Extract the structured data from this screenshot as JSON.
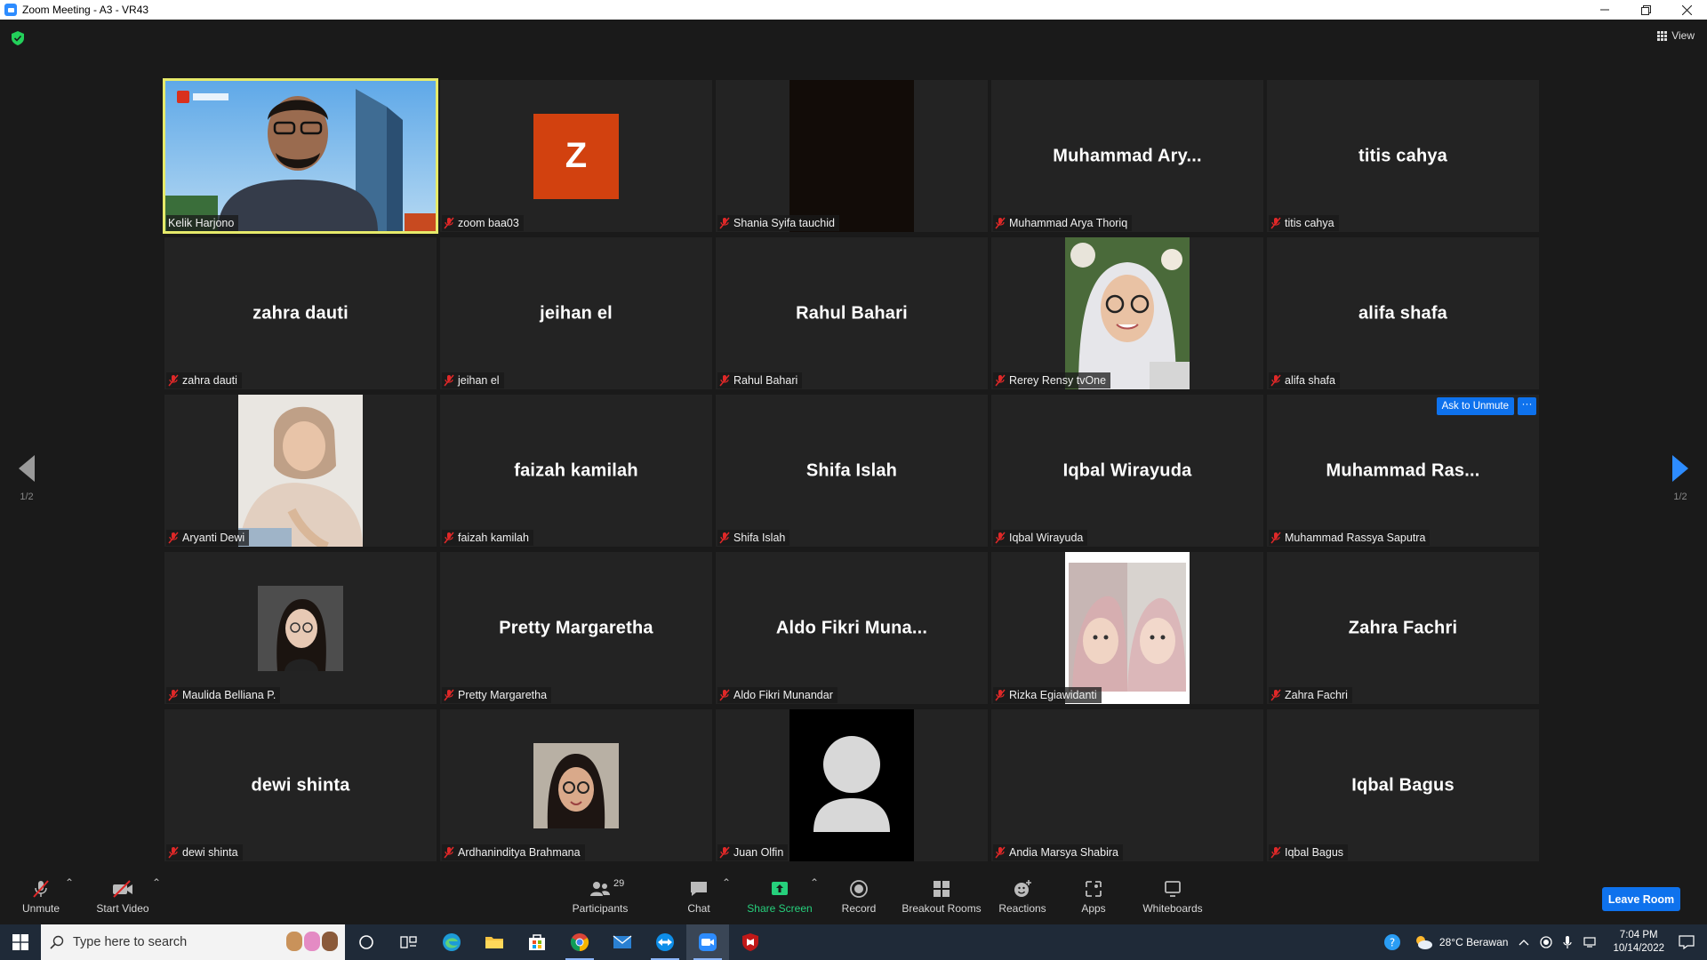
{
  "window": {
    "title": "Zoom Meeting - A3 - VR43"
  },
  "meeting": {
    "view_label": "View",
    "page_left": "1/2",
    "page_right": "1/2",
    "ask_unmute_label": "Ask to Unmute",
    "more_label": "···",
    "tiles": [
      {
        "name": "Kelik Harjono",
        "big": "",
        "type": "video-speaker"
      },
      {
        "name": "zoom baa03",
        "big": "",
        "type": "letter-avatar",
        "letter": "Z"
      },
      {
        "name": "Shania Syifa tauchid",
        "big": "",
        "type": "dark-video"
      },
      {
        "name": "Muhammad Arya Thoriq",
        "big": "Muhammad  Ary...",
        "type": "name"
      },
      {
        "name": "titis cahya",
        "big": "titis cahya",
        "type": "name"
      },
      {
        "name": "zahra dauti",
        "big": "zahra dauti",
        "type": "name"
      },
      {
        "name": "jeihan el",
        "big": "jeihan el",
        "type": "name"
      },
      {
        "name": "Rahul Bahari",
        "big": "Rahul Bahari",
        "type": "name"
      },
      {
        "name": "Rerey Rensy tvOne",
        "big": "",
        "type": "photo-hijab"
      },
      {
        "name": "alifa shafa",
        "big": "alifa shafa",
        "type": "name"
      },
      {
        "name": "Aryanti Dewi",
        "big": "",
        "type": "photo-aryanti"
      },
      {
        "name": "faizah kamilah",
        "big": "faizah kamilah",
        "type": "name"
      },
      {
        "name": "Shifa Islah",
        "big": "Shifa Islah",
        "type": "name"
      },
      {
        "name": "Iqbal Wirayuda",
        "big": "Iqbal Wirayuda",
        "type": "name"
      },
      {
        "name": "Muhammad Rassya Saputra",
        "big": "Muhammad  Ras...",
        "type": "name-ask"
      },
      {
        "name": "Maulida Belliana P.",
        "big": "",
        "type": "avatar-maulida"
      },
      {
        "name": "Pretty Margaretha",
        "big": "Pretty Margaretha",
        "type": "name"
      },
      {
        "name": "Aldo Fikri Munandar",
        "big": "Aldo  Fikri  Muna...",
        "type": "name"
      },
      {
        "name": "Rizka Egiawidanti",
        "big": "",
        "type": "photo-rizka"
      },
      {
        "name": "Zahra Fachri",
        "big": "Zahra Fachri",
        "type": "name"
      },
      {
        "name": "dewi shinta",
        "big": "dewi shinta",
        "type": "name"
      },
      {
        "name": "Ardhaninditya Brahmana",
        "big": "",
        "type": "avatar-ardha"
      },
      {
        "name": "Juan Olfin",
        "big": "",
        "type": "default-avatar"
      },
      {
        "name": "Andia Marsya Shabira",
        "big": "",
        "type": "blank"
      },
      {
        "name": "Iqbal Bagus",
        "big": "Iqbal Bagus",
        "type": "name"
      }
    ]
  },
  "toolbar": {
    "unmute": "Unmute",
    "start_video": "Start Video",
    "participants": "Participants",
    "participants_count": "29",
    "chat": "Chat",
    "share_screen": "Share Screen",
    "record": "Record",
    "breakout_rooms": "Breakout Rooms",
    "reactions": "Reactions",
    "apps": "Apps",
    "whiteboards": "Whiteboards",
    "leave": "Leave Room",
    "accent": "#0e72ed",
    "share_color": "#26d07c"
  },
  "taskbar": {
    "search_placeholder": "Type here to search",
    "weather": "28°C  Berawan",
    "time": "7:04 PM",
    "date": "10/14/2022",
    "apps": [
      "cortana-icon",
      "task-view-icon",
      "edge-icon",
      "file-explorer-icon",
      "store-icon",
      "chrome-icon",
      "mail-icon",
      "teamviewer-icon",
      "zoom-icon",
      "mcafee-icon"
    ]
  }
}
